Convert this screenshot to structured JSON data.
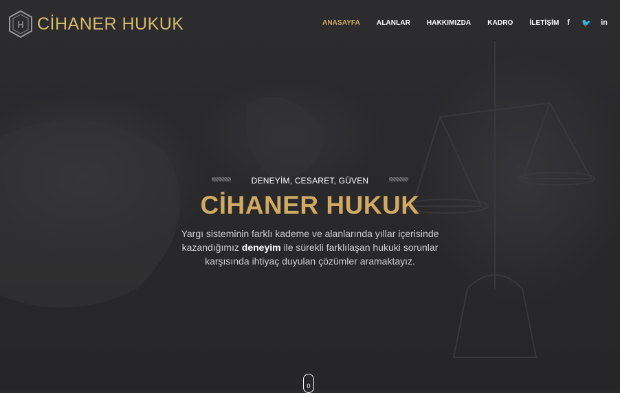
{
  "brand": {
    "name": "CİHANER HUKUK",
    "accent": "#d2a962"
  },
  "nav": {
    "items": [
      {
        "label": "ANASAYFA",
        "active": true
      },
      {
        "label": "ALANLAR",
        "active": false
      },
      {
        "label": "HAKKIMIZDA",
        "active": false
      },
      {
        "label": "KADRO",
        "active": false
      },
      {
        "label": "İLETİŞİM",
        "active": false
      }
    ]
  },
  "social": {
    "facebook": {
      "icon": "facebook-icon",
      "glyph": "f"
    },
    "twitter": {
      "icon": "twitter-icon",
      "glyph": "🐦"
    },
    "linkedin": {
      "icon": "linkedin-icon",
      "glyph": "in"
    }
  },
  "hero": {
    "tagline": "DENEYİM, CESARET, GÜVEN",
    "title": "CİHANER HUKUK",
    "desc_before": "Yargı sisteminin farklı kademe ve alanlarında yıllar içerisinde kazandığımız ",
    "desc_bold": "deneyim",
    "desc_after": " ile sürekli farklılaşan hukuki sorunlar karşısında ihtiyaç duyulan çözümler aramaktayız."
  },
  "scroll": {
    "label": "0"
  }
}
